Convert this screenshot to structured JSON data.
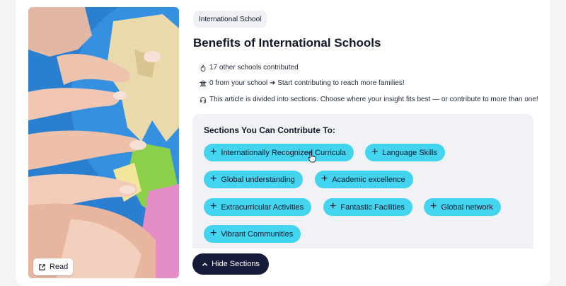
{
  "article": {
    "tag": "International School",
    "title": "Benefits of International Schools",
    "read_label": "Read",
    "info": [
      {
        "icon": "flame-icon",
        "text": "17 other schools contributed"
      },
      {
        "icon": "school-building-icon",
        "text": "0 from your school ➜ Start contributing to reach more families!"
      },
      {
        "icon": "headset-icon",
        "text": "This article is divided into sections. Choose where your insight fits best — or contribute to more than one!"
      }
    ]
  },
  "sections": {
    "heading": "Sections You Can Contribute To:",
    "chips": [
      "Internationally Recognized Curricula",
      "Language Skills",
      "Global understanding",
      "Academic excellence",
      "Extracurricular Activities",
      "Fantastic Facilities",
      "Global network",
      "Vibrant Communities"
    ],
    "chip_color": "#43d4ef"
  },
  "hide_sections_label": "Hide Sections",
  "colors": {
    "dark_button": "#171b3a",
    "panel": "#f1f2f6"
  }
}
